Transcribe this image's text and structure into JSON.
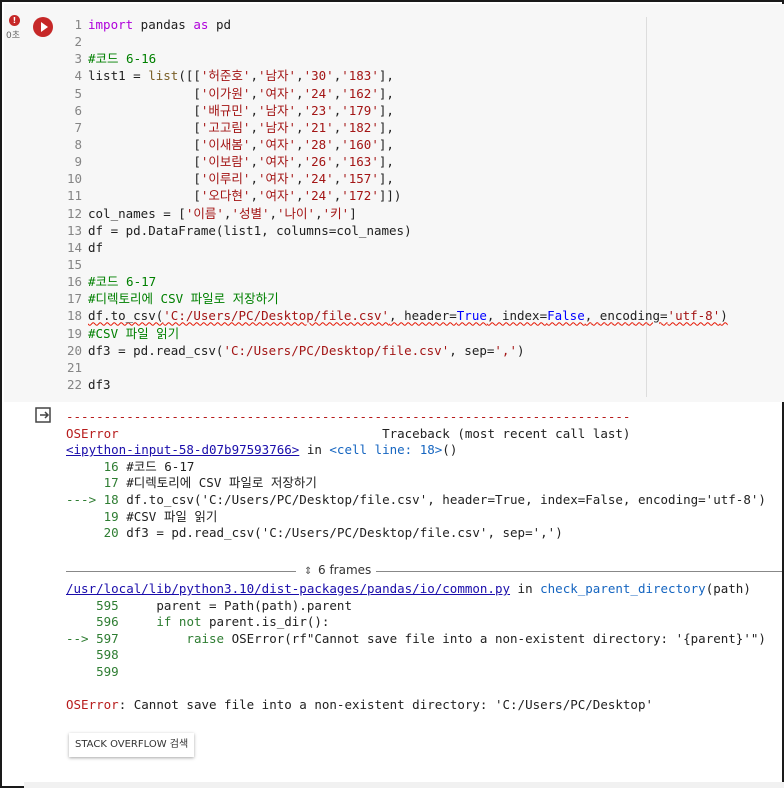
{
  "cell": {
    "error_badge": "!",
    "exec_time": "0초",
    "code_lines": [
      {
        "n": "1",
        "parts": [
          [
            "kw",
            "import"
          ],
          [
            "t",
            " pandas "
          ],
          [
            "kw",
            "as"
          ],
          [
            "t",
            " pd"
          ]
        ]
      },
      {
        "n": "2",
        "parts": []
      },
      {
        "n": "3",
        "parts": [
          [
            "cm",
            "#코드 6-16"
          ]
        ]
      },
      {
        "n": "4",
        "parts": [
          [
            "t",
            "list1 = "
          ],
          [
            "fn",
            "list"
          ],
          [
            "t",
            "([["
          ],
          [
            "str",
            "'허준호'"
          ],
          [
            "t",
            ","
          ],
          [
            "str",
            "'남자'"
          ],
          [
            "t",
            ","
          ],
          [
            "str",
            "'30'"
          ],
          [
            "t",
            ","
          ],
          [
            "str",
            "'183'"
          ],
          [
            "t",
            "],"
          ]
        ]
      },
      {
        "n": "5",
        "parts": [
          [
            "t",
            "              ["
          ],
          [
            "str",
            "'이가원'"
          ],
          [
            "t",
            ","
          ],
          [
            "str",
            "'여자'"
          ],
          [
            "t",
            ","
          ],
          [
            "str",
            "'24'"
          ],
          [
            "t",
            ","
          ],
          [
            "str",
            "'162'"
          ],
          [
            "t",
            "],"
          ]
        ]
      },
      {
        "n": "6",
        "parts": [
          [
            "t",
            "              ["
          ],
          [
            "str",
            "'배규민'"
          ],
          [
            "t",
            ","
          ],
          [
            "str",
            "'남자'"
          ],
          [
            "t",
            ","
          ],
          [
            "str",
            "'23'"
          ],
          [
            "t",
            ","
          ],
          [
            "str",
            "'179'"
          ],
          [
            "t",
            "],"
          ]
        ]
      },
      {
        "n": "7",
        "parts": [
          [
            "t",
            "              ["
          ],
          [
            "str",
            "'고고림'"
          ],
          [
            "t",
            ","
          ],
          [
            "str",
            "'남자'"
          ],
          [
            "t",
            ","
          ],
          [
            "str",
            "'21'"
          ],
          [
            "t",
            ","
          ],
          [
            "str",
            "'182'"
          ],
          [
            "t",
            "],"
          ]
        ]
      },
      {
        "n": "8",
        "parts": [
          [
            "t",
            "              ["
          ],
          [
            "str",
            "'이새봄'"
          ],
          [
            "t",
            ","
          ],
          [
            "str",
            "'여자'"
          ],
          [
            "t",
            ","
          ],
          [
            "str",
            "'28'"
          ],
          [
            "t",
            ","
          ],
          [
            "str",
            "'160'"
          ],
          [
            "t",
            "],"
          ]
        ]
      },
      {
        "n": "9",
        "parts": [
          [
            "t",
            "              ["
          ],
          [
            "str",
            "'이보람'"
          ],
          [
            "t",
            ","
          ],
          [
            "str",
            "'여자'"
          ],
          [
            "t",
            ","
          ],
          [
            "str",
            "'26'"
          ],
          [
            "t",
            ","
          ],
          [
            "str",
            "'163'"
          ],
          [
            "t",
            "],"
          ]
        ]
      },
      {
        "n": "10",
        "parts": [
          [
            "t",
            "              ["
          ],
          [
            "str",
            "'이루리'"
          ],
          [
            "t",
            ","
          ],
          [
            "str",
            "'여자'"
          ],
          [
            "t",
            ","
          ],
          [
            "str",
            "'24'"
          ],
          [
            "t",
            ","
          ],
          [
            "str",
            "'157'"
          ],
          [
            "t",
            "],"
          ]
        ]
      },
      {
        "n": "11",
        "parts": [
          [
            "t",
            "              ["
          ],
          [
            "str",
            "'오다현'"
          ],
          [
            "t",
            ","
          ],
          [
            "str",
            "'여자'"
          ],
          [
            "t",
            ","
          ],
          [
            "str",
            "'24'"
          ],
          [
            "t",
            ","
          ],
          [
            "str",
            "'172'"
          ],
          [
            "t",
            "]])"
          ]
        ]
      },
      {
        "n": "12",
        "parts": [
          [
            "t",
            "col_names = ["
          ],
          [
            "str",
            "'이름'"
          ],
          [
            "t",
            ","
          ],
          [
            "str",
            "'성별'"
          ],
          [
            "t",
            ","
          ],
          [
            "str",
            "'나이'"
          ],
          [
            "t",
            ","
          ],
          [
            "str",
            "'키'"
          ],
          [
            "t",
            "]"
          ]
        ]
      },
      {
        "n": "13",
        "parts": [
          [
            "t",
            "df = pd.DataFrame(list1, columns=col_names)"
          ]
        ]
      },
      {
        "n": "14",
        "parts": [
          [
            "t",
            "df"
          ]
        ]
      },
      {
        "n": "15",
        "parts": []
      },
      {
        "n": "16",
        "parts": [
          [
            "cm",
            "#코드 6-17"
          ]
        ]
      },
      {
        "n": "17",
        "parts": [
          [
            "cm",
            "#디렉토리에 CSV 파일로 저장하기"
          ]
        ]
      },
      {
        "n": "18",
        "squiggle": true,
        "parts": [
          [
            "t",
            "df.to_csv("
          ],
          [
            "str",
            "'C:/Users/PC/Desktop/file.csv'"
          ],
          [
            "t",
            ", header="
          ],
          [
            "bool",
            "True"
          ],
          [
            "t",
            ", index="
          ],
          [
            "bool",
            "False"
          ],
          [
            "t",
            ", encoding="
          ],
          [
            "str",
            "'utf-8'"
          ],
          [
            "t",
            ")"
          ]
        ]
      },
      {
        "n": "19",
        "parts": [
          [
            "cm",
            "#CSV 파일 읽기"
          ]
        ]
      },
      {
        "n": "20",
        "parts": [
          [
            "t",
            "df3 = pd.read_csv("
          ],
          [
            "str",
            "'C:/Users/PC/Desktop/file.csv'"
          ],
          [
            "t",
            ", sep="
          ],
          [
            "str",
            "','"
          ],
          [
            "t",
            ")"
          ]
        ]
      },
      {
        "n": "21",
        "parts": []
      },
      {
        "n": "22",
        "parts": [
          [
            "t",
            "df3"
          ]
        ]
      }
    ]
  },
  "output": {
    "lines": [
      [
        [
          "red",
          "---------------------------------------------------------------------------"
        ]
      ],
      [
        [
          "red",
          "OSError"
        ],
        [
          "t",
          "                                   Traceback (most recent call last)"
        ]
      ],
      [
        [
          "link",
          "<ipython-input-58-d07b97593766>"
        ],
        [
          "t",
          " in "
        ],
        [
          "blue",
          "<cell line: 18>"
        ],
        [
          "t",
          "()"
        ]
      ],
      [
        [
          "t",
          "     "
        ],
        [
          "green",
          "16"
        ],
        [
          "t",
          " #코드 6-17"
        ]
      ],
      [
        [
          "t",
          "     "
        ],
        [
          "green",
          "17"
        ],
        [
          "t",
          " #디렉토리에 CSV 파일로 저장하기"
        ]
      ],
      [
        [
          "green",
          "---> 18"
        ],
        [
          "t",
          " df.to_csv('C:/Users/PC/Desktop/file.csv', header=True, index=False, encoding='utf-8')"
        ]
      ],
      [
        [
          "t",
          "     "
        ],
        [
          "green",
          "19"
        ],
        [
          "t",
          " #CSV 파일 읽기"
        ]
      ],
      [
        [
          "t",
          "     "
        ],
        [
          "green",
          "20"
        ],
        [
          "t",
          " df3 = pd.read_csv('C:/Users/PC/Desktop/file.csv', sep=',')"
        ]
      ]
    ],
    "frames_label": "6 frames",
    "lines2": [
      [
        [
          "link",
          "/usr/local/lib/python3.10/dist-packages/pandas/io/common.py"
        ],
        [
          "t",
          " in "
        ],
        [
          "blue",
          "check_parent_directory"
        ],
        [
          "t",
          "(path)"
        ]
      ],
      [
        [
          "t",
          "    "
        ],
        [
          "green",
          "595"
        ],
        [
          "t",
          "     parent = Path(path).parent"
        ]
      ],
      [
        [
          "t",
          "    "
        ],
        [
          "green",
          "596"
        ],
        [
          "t",
          "     "
        ],
        [
          "green",
          "if"
        ],
        [
          "t",
          " "
        ],
        [
          "green",
          "not"
        ],
        [
          "t",
          " parent.is_dir():"
        ]
      ],
      [
        [
          "green",
          "--> 597"
        ],
        [
          "t",
          "         "
        ],
        [
          "green",
          "raise"
        ],
        [
          "t",
          " OSError(rf\"Cannot save file into a non-existent directory: '{parent}'\")"
        ]
      ],
      [
        [
          "t",
          "    "
        ],
        [
          "green",
          "598"
        ]
      ],
      [
        [
          "t",
          "    "
        ],
        [
          "green",
          "599"
        ]
      ],
      [],
      [
        [
          "red",
          "OSError"
        ],
        [
          "t",
          ": Cannot save file into a non-existent directory: 'C:/Users/PC/Desktop'"
        ]
      ]
    ],
    "stack_overflow_button": "STACK OVERFLOW 검색"
  }
}
